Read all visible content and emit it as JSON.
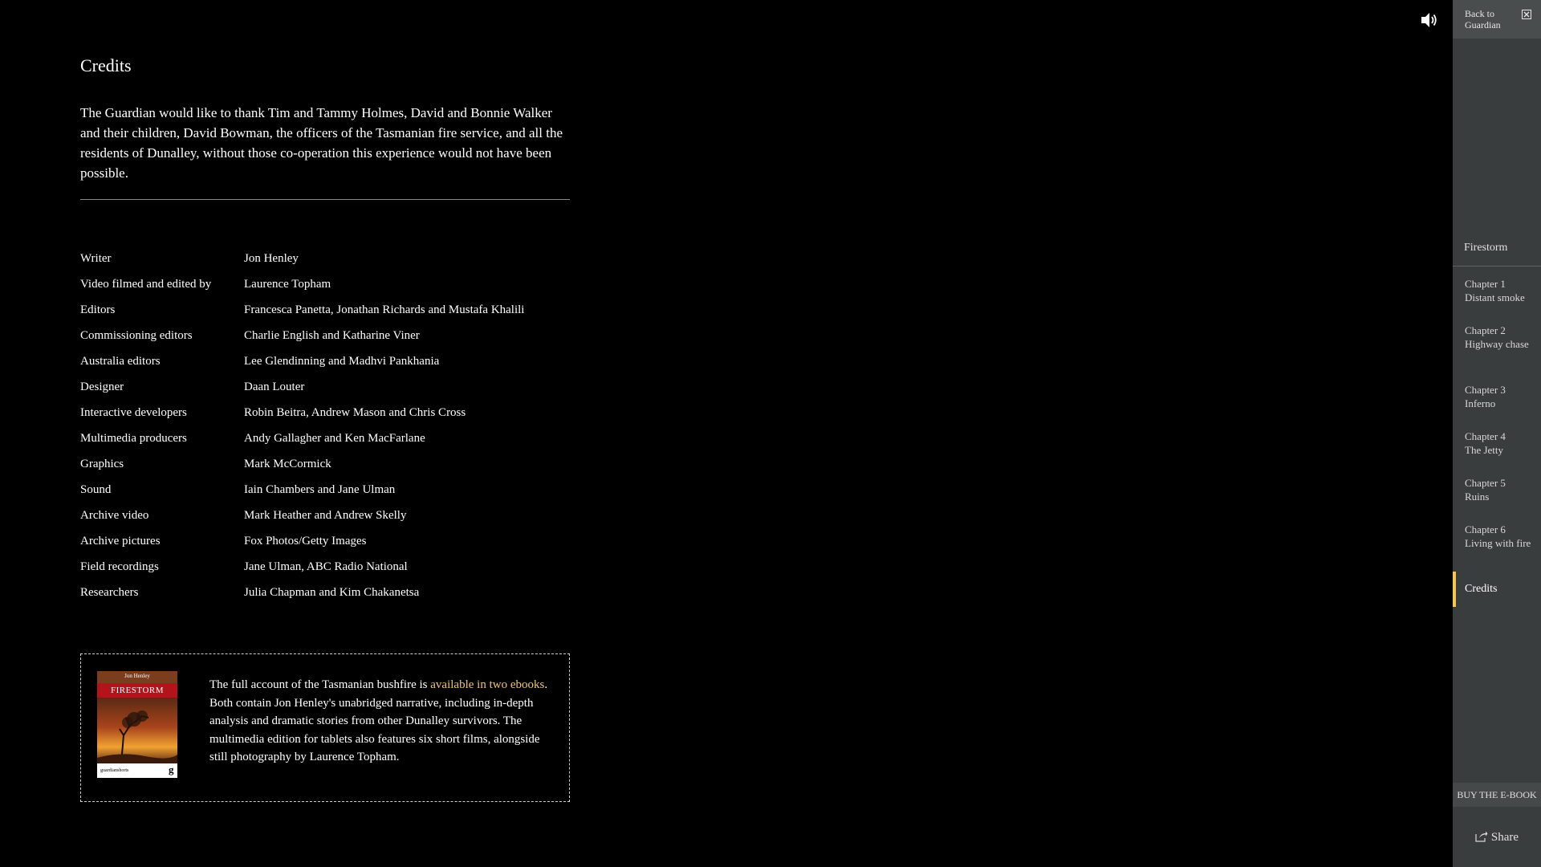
{
  "main": {
    "title": "Credits",
    "thanks": "The Guardian would like to thank Tim and Tammy Holmes, David and Bonnie Walker and their children, David Bowman, the officers of the Tasmanian fire service, and all the residents of Dunalley, without those co-operation this experience would not have been possible.",
    "credits": [
      {
        "role": "Writer",
        "names": "Jon Henley"
      },
      {
        "role": "Video filmed and edited by",
        "names": "Laurence Topham"
      },
      {
        "role": "Editors",
        "names": "Francesca Panetta, Jonathan Richards and Mustafa Khalili"
      },
      {
        "role": "Commissioning editors",
        "names": "Charlie English and Katharine Viner"
      },
      {
        "role": "Australia editors",
        "names": "Lee Glendinning and Madhvi Pankhania"
      },
      {
        "role": "Designer",
        "names": "Daan Louter"
      },
      {
        "role": "Interactive developers",
        "names": "Robin Beitra, Andrew Mason and Chris Cross"
      },
      {
        "role": "Multimedia producers",
        "names": "Andy Gallagher and Ken MacFarlane"
      },
      {
        "role": "Graphics",
        "names": "Mark McCormick"
      },
      {
        "role": "Sound",
        "names": "Iain Chambers and Jane Ulman"
      },
      {
        "role": "Archive video",
        "names": "Mark Heather and Andrew Skelly"
      },
      {
        "role": "Archive pictures",
        "names": "Fox Photos/Getty Images"
      },
      {
        "role": "Field recordings",
        "names": "Jane Ulman, ABC Radio National"
      },
      {
        "role": "Researchers",
        "names": "Julia Chapman and Kim Chakanetsa"
      }
    ],
    "ebook": {
      "text_before": "The full account of the Tasmanian bushfire is ",
      "link": "available in two ebooks",
      "text_after": ". Both contain Jon Henley's unabridged narrative, including in-depth analysis and dramatic stories from other Dunalley survivors. The multimedia edition for tablets also features six short films, alongside still photography by Laurence Topham.",
      "cover_author": "Jon Henley",
      "cover_title": "FIRESTORM",
      "cover_brand": "guardianshorts",
      "cover_logo": "g"
    }
  },
  "sidebar": {
    "back_label": "Back to Guardian",
    "story_title": "Firestorm",
    "chapters": [
      {
        "num": "Chapter 1",
        "name": "Distant smoke"
      },
      {
        "num": "Chapter 2",
        "name": "Highway chase"
      },
      {
        "num": "Chapter 3",
        "name": "Inferno"
      },
      {
        "num": "Chapter 4",
        "name": "The Jetty"
      },
      {
        "num": "Chapter 5",
        "name": "Ruins"
      },
      {
        "num": "Chapter 6",
        "name": "Living with fire"
      }
    ],
    "active_item": "Credits",
    "buy_label": "BUY THE E-BOOK",
    "share_label": "Share"
  },
  "icons": {
    "sound": "speaker-volume-icon",
    "close": "close-box-icon",
    "share": "share-arrow-icon"
  },
  "colors": {
    "background": "#000000",
    "sidebar": "#3a3d3d",
    "accent": "#f5c652",
    "link": "#f0c27a"
  }
}
